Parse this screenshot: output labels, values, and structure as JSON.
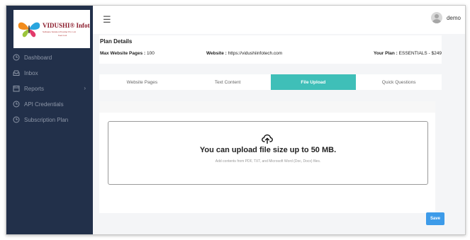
{
  "logo": {
    "brand": "VIDUSHI® Infotech",
    "tagline": "Software Solution Provider Pvt. Ltd.",
    "sub": "Feel cool"
  },
  "sidebar": {
    "items": [
      {
        "label": "Dashboard",
        "icon": "clock-icon"
      },
      {
        "label": "Inbox",
        "icon": "inbox-icon"
      },
      {
        "label": "Reports",
        "icon": "calendar-icon",
        "chevron": "›"
      },
      {
        "label": "API Credentials",
        "icon": "clock-icon"
      },
      {
        "label": "Subscription Plan",
        "icon": "clock-icon"
      }
    ]
  },
  "topbar": {
    "menu_icon": "☰",
    "user_name": "demo"
  },
  "plan": {
    "title": "Plan Details",
    "max_pages_label": "Max Website Pages :",
    "max_pages_value": "100",
    "website_label": "Website :",
    "website_value": "https://vidushiinfotech.com",
    "your_plan_label": "Your Plan :",
    "your_plan_value": "ESSENTIALS - $249"
  },
  "tabs": [
    {
      "label": "Website Pages",
      "active": false
    },
    {
      "label": "Text Content",
      "active": false
    },
    {
      "label": "File Upload",
      "active": true
    },
    {
      "label": "Quick Questions",
      "active": false
    }
  ],
  "upload": {
    "title": "You can upload file size up to 50 MB.",
    "subtitle": "Add contents from PDF, TXT, and Microsoft Word (Doc, Docx) files."
  },
  "actions": {
    "save_label": "Save"
  },
  "colors": {
    "sidebar_bg": "#22304a",
    "tab_active": "#3fbfb8",
    "save_button": "#3d9be9"
  }
}
